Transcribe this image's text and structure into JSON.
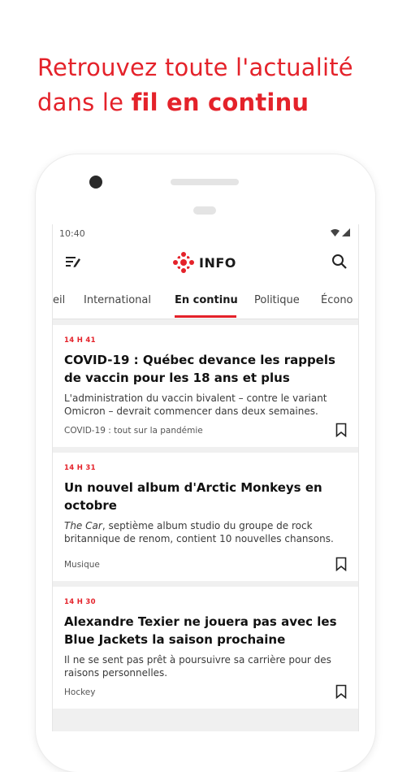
{
  "promo": {
    "line1": "Retrouvez toute l'actualité",
    "line2_plain": "dans le ",
    "line2_bold": "fil en continu"
  },
  "status": {
    "time": "10:40"
  },
  "appbar": {
    "logo_text": "INFO"
  },
  "tabs": [
    {
      "label": "eil"
    },
    {
      "label": "International"
    },
    {
      "label": "En continu",
      "active": true
    },
    {
      "label": "Politique"
    },
    {
      "label": "Écono"
    }
  ],
  "articles": [
    {
      "time": "14 H 41",
      "title": "COVID-19 : Québec devance les rappels de vaccin pour les 18 ans et plus",
      "desc": "L'administration du vaccin bivalent – contre le variant Omicron – devrait commencer dans deux semaines.",
      "tag": "COVID-19 : tout sur la pandémie"
    },
    {
      "time": "14 H 31",
      "title": "Un nouvel album d'Arctic Monkeys en octobre",
      "desc_italic": "The Car",
      "desc": ", septième album studio du groupe de rock britannique de renom, contient 10 nouvelles chansons.",
      "tag": "Musique"
    },
    {
      "time": "14 H 30",
      "title": "Alexandre Texier ne jouera pas avec les Blue Jackets la saison prochaine",
      "desc": "Il ne se sent pas prêt à poursuivre sa carrière pour des raisons personnelles.",
      "tag": "Hockey"
    }
  ],
  "colors": {
    "accent": "#e4222a",
    "background": "#f0f0f0"
  },
  "icons": [
    "menu-icon",
    "radio-canada-logo-icon",
    "search-icon",
    "bookmark-icon",
    "wifi-icon",
    "signal-icon"
  ]
}
